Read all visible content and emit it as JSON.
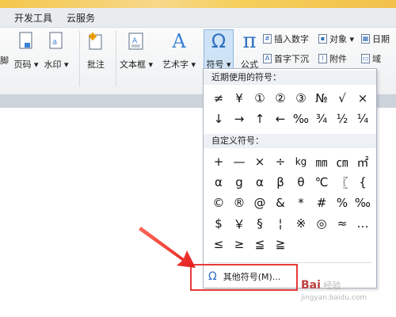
{
  "tabs": [
    {
      "label": "开发工具"
    },
    {
      "label": "云服务"
    }
  ],
  "ribbon": {
    "partial_left": "脚",
    "buttons": [
      {
        "label": "页码 ▾",
        "icon": "page-number-icon"
      },
      {
        "label": "水印 ▾",
        "icon": "watermark-icon"
      },
      {
        "label": "批注",
        "icon": "comment-icon"
      },
      {
        "label": "文本框 ▾",
        "icon": "textbox-icon"
      },
      {
        "label": "艺术字 ▾",
        "icon": "wordart-icon",
        "glyph": "A"
      },
      {
        "label": "符号 ▾",
        "icon": "omega-icon",
        "glyph": "Ω"
      },
      {
        "label": "公式",
        "icon": "pi-icon",
        "glyph": "π"
      }
    ],
    "small": [
      {
        "label": "插入数字",
        "icon": "insert-number-icon"
      },
      {
        "label": "对象 ▾",
        "icon": "object-icon"
      },
      {
        "label": "日期",
        "icon": "date-icon"
      },
      {
        "label": "首字下沉",
        "icon": "dropcap-icon"
      },
      {
        "label": "附件",
        "icon": "attachment-icon"
      },
      {
        "label": "域",
        "icon": "field-icon"
      }
    ]
  },
  "symbols": {
    "recent_header": "近期使用的符号：",
    "recent": [
      "≠",
      "¥",
      "①",
      "②",
      "③",
      "№",
      "√",
      "×",
      "↓",
      "→",
      "↑",
      "←",
      "‰",
      "¾",
      "½",
      "¼"
    ],
    "custom_header": "自定义符号：",
    "custom": [
      "+",
      "—",
      "×",
      "÷",
      "kg",
      "㎜",
      "㎝",
      "㎡",
      "α",
      "g",
      "α",
      "β",
      "θ",
      "℃",
      "〖",
      "{",
      "©",
      "®",
      "@",
      "&",
      "*",
      "#",
      "%",
      "‰",
      "$",
      "￥",
      "§",
      "¦",
      "※",
      "◎",
      "≈",
      "…",
      "≤",
      "≥",
      "≦",
      "≧"
    ],
    "more_label": "其他符号(M)...",
    "more_icon": "omega-icon"
  },
  "watermark": "Bai 经验\njingyan.baidu.com"
}
